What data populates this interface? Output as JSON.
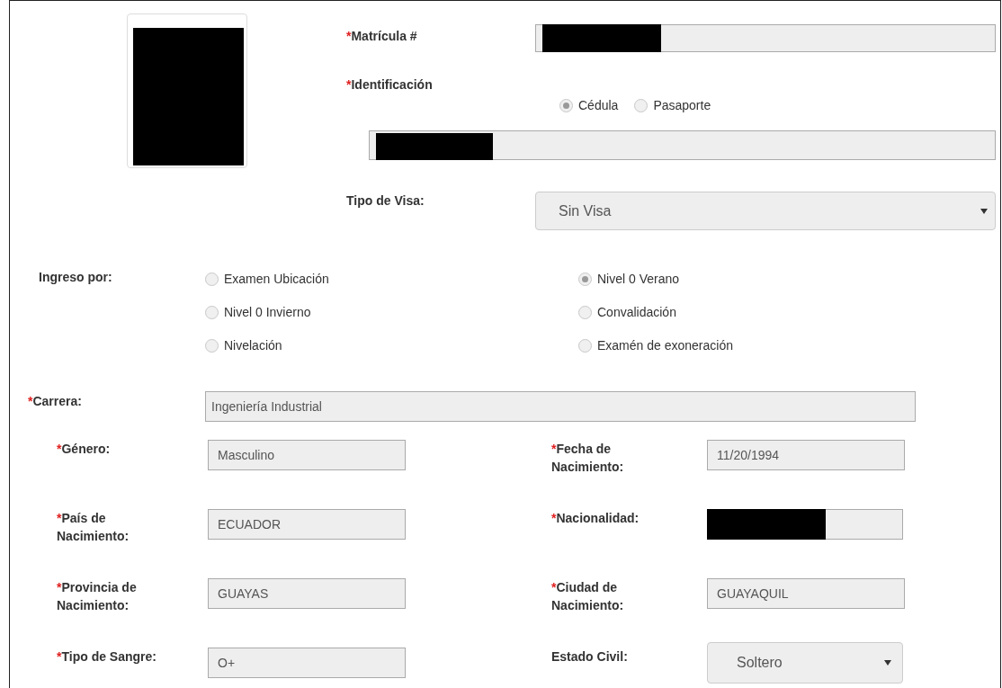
{
  "photo": {
    "redacted": true
  },
  "matricula": {
    "mark": "*",
    "label": "Matrícula #",
    "redacted": true
  },
  "identificacion": {
    "mark": "*",
    "label": "Identificación",
    "options": [
      {
        "label": "Cédula",
        "selected": true
      },
      {
        "label": "Pasaporte",
        "selected": false
      }
    ],
    "redacted": true
  },
  "tipo_visa": {
    "label": "Tipo de Visa:",
    "value": "Sin Visa"
  },
  "ingreso": {
    "label": "Ingreso por:",
    "options": [
      {
        "label": "Examen Ubicación",
        "selected": false
      },
      {
        "label": "Nivel 0 Verano",
        "selected": true
      },
      {
        "label": "Nivel 0 Invierno",
        "selected": false
      },
      {
        "label": "Convalidación",
        "selected": false
      },
      {
        "label": "Nivelación",
        "selected": false
      },
      {
        "label": "Examén de exoneración",
        "selected": false
      }
    ]
  },
  "carrera": {
    "mark": "*",
    "label": "Carrera:",
    "value": "Ingeniería Industrial"
  },
  "fields": [
    {
      "mark": "*",
      "label": "Género:",
      "kind": "text",
      "value": "Masculino"
    },
    {
      "mark": "*",
      "label": "Fecha de Nacimiento:",
      "kind": "text",
      "value": "11/20/1994"
    },
    {
      "mark": "*",
      "label": "País de Nacimiento:",
      "kind": "text",
      "value": "ECUADOR"
    },
    {
      "mark": "*",
      "label": "Nacionalidad:",
      "kind": "redacted"
    },
    {
      "mark": "*",
      "label": "Provincia de Nacimiento:",
      "kind": "text",
      "value": "GUAYAS"
    },
    {
      "mark": "*",
      "label": "Ciudad de Nacimiento:",
      "kind": "text",
      "value": "GUAYAQUIL"
    },
    {
      "mark": "*",
      "label": "Tipo de Sangre:",
      "kind": "text",
      "value": "O+"
    },
    {
      "label": "Estado Civil:",
      "kind": "select",
      "value": "Soltero"
    }
  ]
}
